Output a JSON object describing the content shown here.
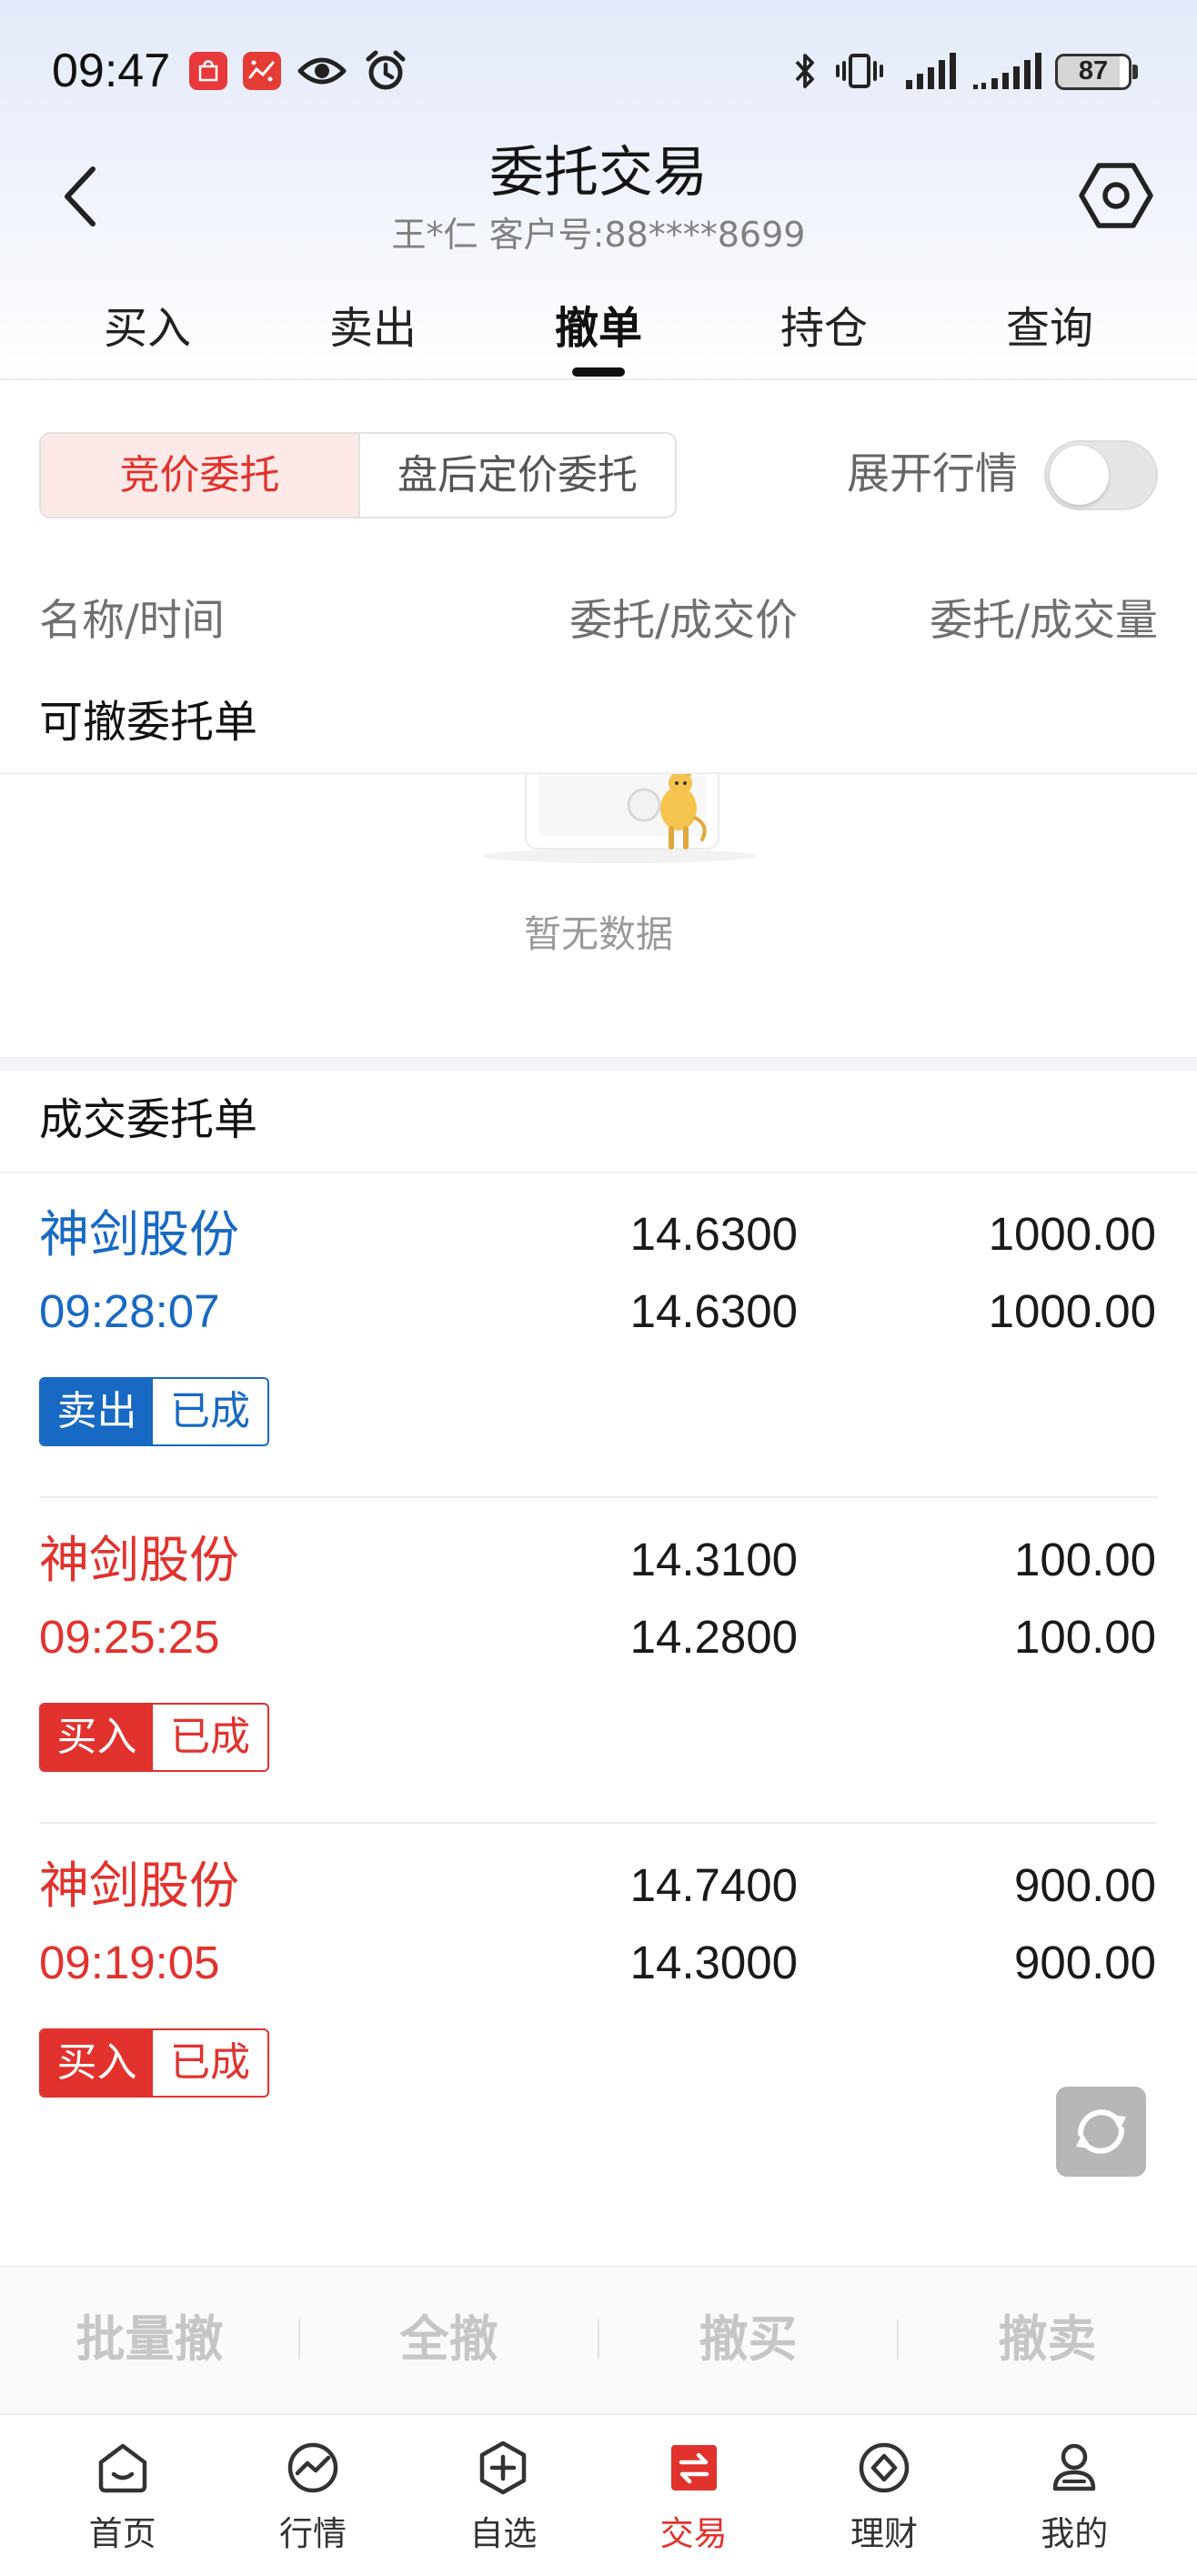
{
  "colors": {
    "red": "#e2322d",
    "blue": "#1769c4",
    "segment_active_bg": "#fde9e7",
    "disabled_text": "#c6c6c6"
  },
  "status_bar": {
    "time": "09:47",
    "left_icons": [
      "huawei-appgallery-icon",
      "app-notification-icon",
      "eye-icon",
      "alarm-icon"
    ],
    "right_icons": [
      "bluetooth-icon",
      "vibrate-icon",
      "signal-icon",
      "signal-icon"
    ],
    "battery": "87"
  },
  "header": {
    "back_icon": "chevron-left-icon",
    "title": "委托交易",
    "subtitle": "王*仁 客户号:88****8699",
    "settings_icon": "hexagon-settings-icon"
  },
  "tabs": [
    {
      "label": "买入",
      "active": false
    },
    {
      "label": "卖出",
      "active": false
    },
    {
      "label": "撤单",
      "active": true
    },
    {
      "label": "持仓",
      "active": false
    },
    {
      "label": "查询",
      "active": false
    }
  ],
  "order_type_segment": {
    "options": [
      {
        "label": "竞价委托",
        "selected": true
      },
      {
        "label": "盘后定价委托",
        "selected": false
      }
    ]
  },
  "market_toggle": {
    "label": "展开行情",
    "on": false
  },
  "columns": {
    "name_time": "名称/时间",
    "price": "委托/成交价",
    "volume": "委托/成交量"
  },
  "cancellable_orders": {
    "title": "可撤委托单",
    "items": [],
    "empty_text": "暂无数据"
  },
  "filled_orders": {
    "title": "成交委托单",
    "items": [
      {
        "name": "神剑股份",
        "time": "09:28:07",
        "order_price": "14.6300",
        "fill_price": "14.6300",
        "order_qty": "1000.00",
        "fill_qty": "1000.00",
        "side": "卖出",
        "status": "已成",
        "color": "#1769c4"
      },
      {
        "name": "神剑股份",
        "time": "09:25:25",
        "order_price": "14.3100",
        "fill_price": "14.2800",
        "order_qty": "100.00",
        "fill_qty": "100.00",
        "side": "买入",
        "status": "已成",
        "color": "#e2322d"
      },
      {
        "name": "神剑股份",
        "time": "09:19:05",
        "order_price": "14.7400",
        "fill_price": "14.3000",
        "order_qty": "900.00",
        "fill_qty": "900.00",
        "side": "买入",
        "status": "已成",
        "color": "#e2322d"
      }
    ]
  },
  "refresh_icon": "refresh-icon",
  "actions": [
    {
      "label": "批量撤",
      "enabled": false
    },
    {
      "label": "全撤",
      "enabled": false
    },
    {
      "label": "撤买",
      "enabled": false
    },
    {
      "label": "撤卖",
      "enabled": false
    }
  ],
  "bottom_nav": [
    {
      "label": "首页",
      "icon": "home-icon",
      "active": false
    },
    {
      "label": "行情",
      "icon": "market-chart-icon",
      "active": false
    },
    {
      "label": "自选",
      "icon": "watchlist-add-icon",
      "active": false
    },
    {
      "label": "交易",
      "icon": "trade-exchange-icon",
      "active": true
    },
    {
      "label": "理财",
      "icon": "wealth-diamond-icon",
      "active": false
    },
    {
      "label": "我的",
      "icon": "profile-icon",
      "active": false
    }
  ]
}
